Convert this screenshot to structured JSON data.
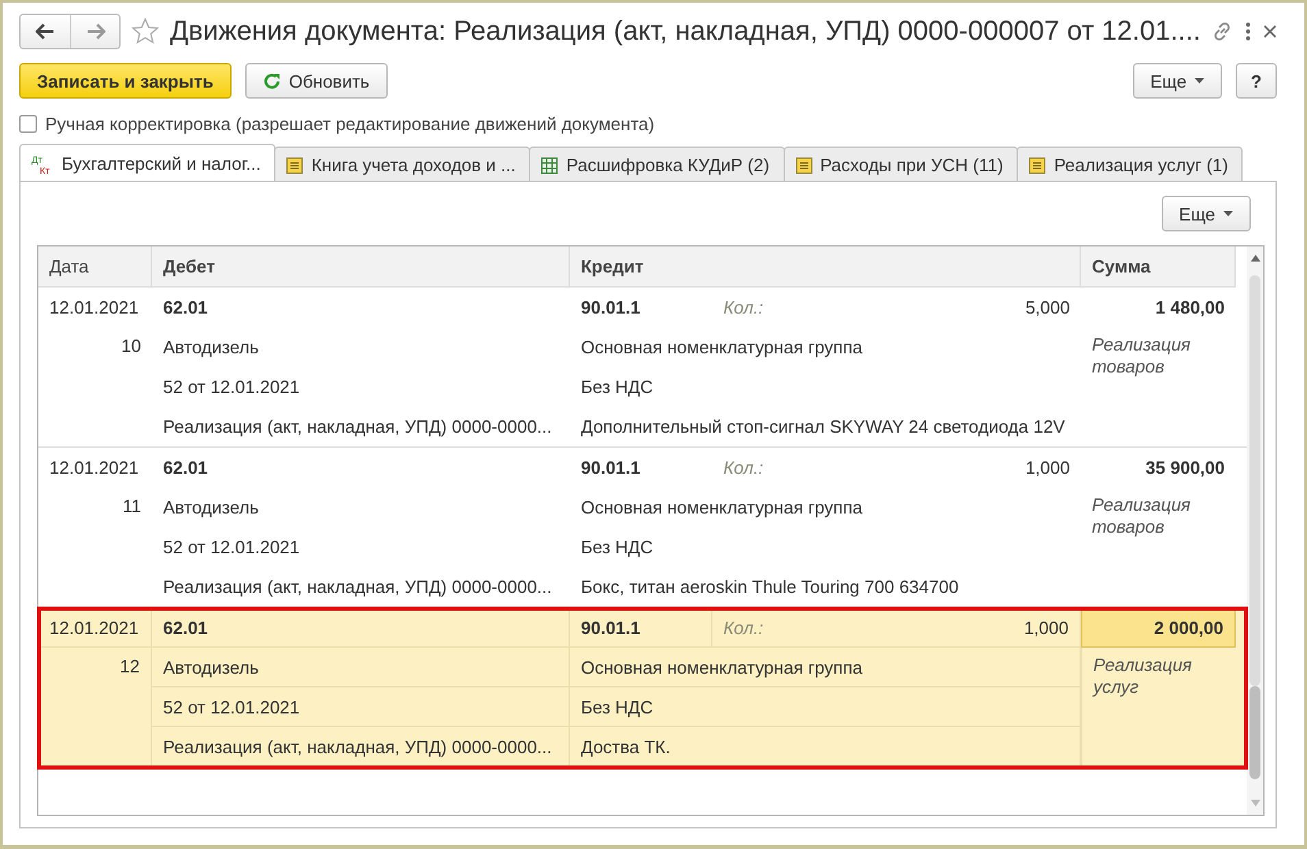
{
  "window": {
    "title": "Движения документа: Реализация (акт, накладная, УПД) 0000-000007 от 12.01...."
  },
  "toolbar": {
    "primary": "Записать и закрыть",
    "refresh": "Обновить",
    "more": "Еще",
    "help": "?"
  },
  "manual_edit": {
    "label": "Ручная корректировка (разрешает редактирование движений документа)",
    "checked": false
  },
  "tabs": [
    {
      "label": "Бухгалтерский и налог...",
      "kind": "accounting",
      "icon_labels": [
        "Дт",
        "Кт"
      ],
      "selected": true
    },
    {
      "label": "Книга учета доходов и ...",
      "kind": "register",
      "selected": false
    },
    {
      "label": "Расшифровка КУДиР (2)",
      "kind": "table",
      "selected": false
    },
    {
      "label": "Расходы при УСН (11)",
      "kind": "register",
      "selected": false
    },
    {
      "label": "Реализация услуг (1)",
      "kind": "register",
      "selected": false
    }
  ],
  "panel": {
    "more": "Еще"
  },
  "table": {
    "columns": [
      "Дата",
      "Дебет",
      "Кредит",
      "Сумма"
    ],
    "rows": [
      {
        "date": "12.01.2021",
        "number": "10",
        "debit_account": "62.01",
        "debit_lines": [
          "Автодизель",
          "52 от 12.01.2021",
          "Реализация (акт, накладная, УПД) 0000-0000..."
        ],
        "credit_account": "90.01.1",
        "qty_label": "Кол.:",
        "qty": "5,000",
        "credit_lines": [
          "Основная номенклатурная группа",
          "Без НДС",
          "Дополнительный стоп-сигнал SKYWAY 24 светодиода 12V"
        ],
        "amount": "1 480,00",
        "amount_note": "Реализация товаров",
        "selected": false
      },
      {
        "date": "12.01.2021",
        "number": "11",
        "debit_account": "62.01",
        "debit_lines": [
          "Автодизель",
          "52 от 12.01.2021",
          "Реализация (акт, накладная, УПД) 0000-0000..."
        ],
        "credit_account": "90.01.1",
        "qty_label": "Кол.:",
        "qty": "1,000",
        "credit_lines": [
          "Основная номенклатурная группа",
          "Без НДС",
          "Бокс, титан aeroskin Thule Touring 700 634700"
        ],
        "amount": "35 900,00",
        "amount_note": "Реализация товаров",
        "selected": false
      },
      {
        "date": "12.01.2021",
        "number": "12",
        "debit_account": "62.01",
        "debit_lines": [
          "Автодизель",
          "52 от 12.01.2021",
          "Реализация (акт, накладная, УПД) 0000-0000..."
        ],
        "credit_account": "90.01.1",
        "qty_label": "Кол.:",
        "qty": "1,000",
        "credit_lines": [
          "Основная номенклатурная группа",
          "Без НДС",
          "Доства ТК."
        ],
        "amount": "2 000,00",
        "amount_note": "Реализация услуг",
        "selected": true
      }
    ]
  }
}
